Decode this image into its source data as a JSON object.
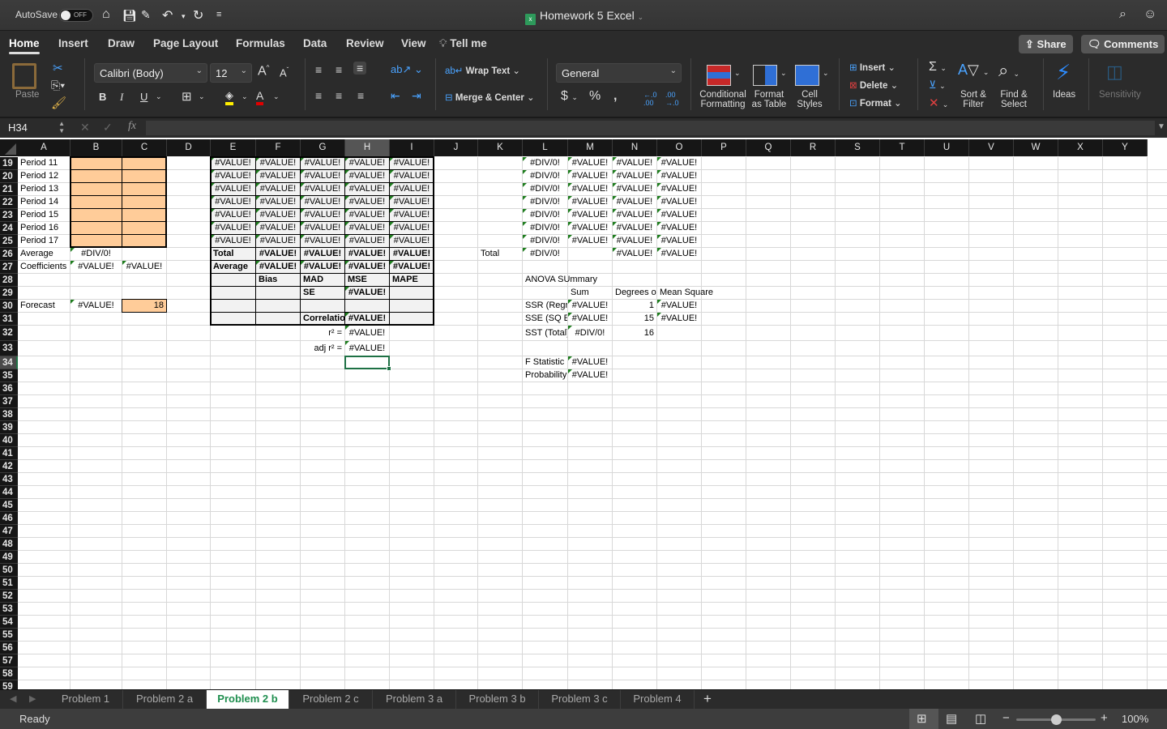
{
  "titlebar": {
    "autosave_label": "AutoSave",
    "autosave_state": "OFF",
    "title": "Homework 5 Excel",
    "icons": [
      "home-icon",
      "save-icon",
      "edit-icon",
      "undo-icon",
      "redo-icon",
      "customize-icon",
      "search-icon",
      "smiley-icon"
    ]
  },
  "ribbon": {
    "tabs": [
      "Home",
      "Insert",
      "Draw",
      "Page Layout",
      "Formulas",
      "Data",
      "Review",
      "View"
    ],
    "active_tab": "Home",
    "tell_me": "Tell me",
    "share_label": "Share",
    "comments_label": "Comments",
    "paste_label": "Paste",
    "font_name": "Calibri (Body)",
    "font_size": "12",
    "wrap_text": "Wrap Text",
    "merge_center": "Merge & Center",
    "number_format": "General",
    "conditional_formatting": "Conditional Formatting",
    "cf_line1": "Conditional",
    "cf_line2": "Formatting",
    "fat_line1": "Format",
    "fat_line2": "as Table",
    "cs_line1": "Cell",
    "cs_line2": "Styles",
    "insert": "Insert",
    "delete": "Delete",
    "format": "Format",
    "sort_line1": "Sort &",
    "sort_line2": "Filter",
    "find_line1": "Find &",
    "find_line2": "Select",
    "ideas": "Ideas",
    "sensitivity": "Sensitivity",
    "bold": "B",
    "italic": "I",
    "underline": "U"
  },
  "formula_bar": {
    "name_box": "H34",
    "fx": "fx",
    "formula": ""
  },
  "columns": [
    "A",
    "B",
    "C",
    "D",
    "E",
    "F",
    "G",
    "H",
    "I",
    "J",
    "K",
    "L",
    "M",
    "N",
    "O",
    "P",
    "Q",
    "R",
    "S",
    "T",
    "U",
    "V",
    "W",
    "X",
    "Y"
  ],
  "selected_column": "H",
  "rows": [
    "19",
    "20",
    "21",
    "22",
    "23",
    "24",
    "25",
    "26",
    "27",
    "28",
    "29",
    "30",
    "31",
    "32",
    "33",
    "34",
    "35",
    "36",
    "37",
    "38",
    "39",
    "40",
    "41",
    "42",
    "43",
    "44",
    "45",
    "46",
    "47",
    "48",
    "49",
    "50",
    "51",
    "52",
    "53",
    "54",
    "55",
    "56",
    "57",
    "58",
    "59"
  ],
  "selected_row": "34",
  "cells": {
    "periods": [
      "Period 11",
      "Period 12",
      "Period 13",
      "Period 14",
      "Period 15",
      "Period 16",
      "Period 17"
    ],
    "A26": "Average",
    "B26": "#DIV/0!",
    "A27": "Coefficients",
    "B27": "#VALUE!",
    "C27": "#VALUE!",
    "A30": "Forecast",
    "B30": "#VALUE!",
    "C30": "18",
    "err_value": "#VALUE!",
    "err_div": "#DIV/0!",
    "E26": "Total",
    "E27": "Average",
    "F28": "Bias",
    "G28": "MAD",
    "H28": "MSE",
    "I28": "MAPE",
    "G29": "SE",
    "H29": "#VALUE!",
    "G31": "Correlation",
    "H31": "#VALUE!",
    "G32": "r² =",
    "H32": "#VALUE!",
    "G33": "adj r² =",
    "H33": "#VALUE!",
    "K26": "Total",
    "L26": "#DIV/0!",
    "N26": "#VALUE!",
    "O26": "#VALUE!",
    "L28": "ANOVA SUmmary",
    "M29": "Sum",
    "N29": "Degrees of",
    "O29": "Mean Square",
    "L30": "SSR (Regression)",
    "M30": "#VALUE!",
    "N30": "1",
    "O30": "#VALUE!",
    "L31": "SSE (SQ Error)",
    "M31": "#VALUE!",
    "N31": "15",
    "O31": "#VALUE!",
    "L32": "SST (Total)",
    "M32": "#DIV/0!",
    "N32": "16",
    "L34": "F Statistic",
    "M34": "#VALUE!",
    "L35": "Probability",
    "M35": "#VALUE!"
  },
  "sheet_tabs": [
    "Problem 1",
    "Problem 2 a",
    "Problem 2 b",
    "Problem 2 c",
    "Problem 3 a",
    "Problem 3 b",
    "Problem 3 c",
    "Problem 4"
  ],
  "active_sheet": "Problem 2 b",
  "status": {
    "ready": "Ready",
    "zoom": "100%",
    "zoom_fraction": 0.5
  }
}
